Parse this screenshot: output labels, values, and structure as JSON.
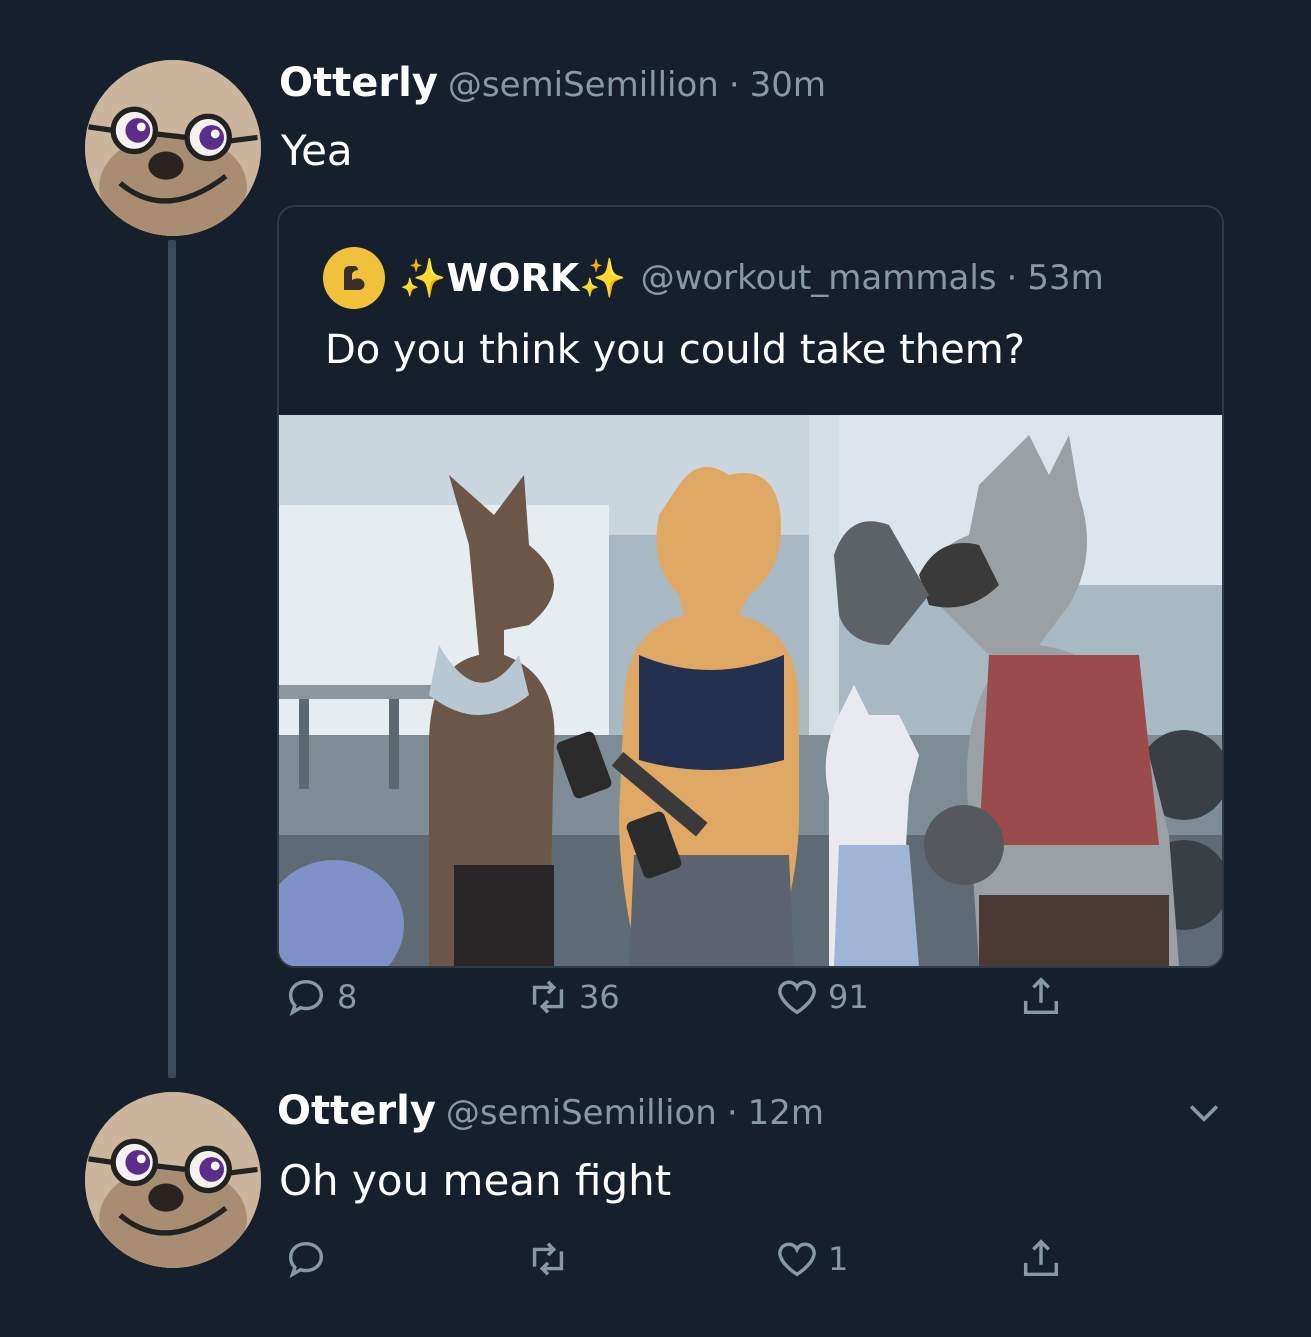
{
  "tweet1": {
    "name": "Otterly",
    "handle": "@semiSemillion",
    "separator": "·",
    "time": "30m",
    "text": "Yea",
    "quote": {
      "name": "✨WORK✨",
      "handle": "@workout_mammals",
      "separator": "·",
      "time": "53m",
      "text": "Do you think you could take them?"
    },
    "actions": {
      "replies": "8",
      "retweets": "36",
      "likes": "91"
    }
  },
  "tweet2": {
    "name": "Otterly",
    "handle": "@semiSemillion",
    "separator": "·",
    "time": "12m",
    "text": "Oh you mean fight",
    "actions": {
      "replies": "",
      "retweets": "",
      "likes": "1"
    }
  },
  "icons": {
    "reply": "reply-icon",
    "retweet": "retweet-icon",
    "like": "heart-icon",
    "share": "share-icon",
    "more": "chevron-down-icon"
  },
  "colors": {
    "background": "#16202c",
    "secondary_text": "#8899a6",
    "thread_line": "#3b4a5a",
    "card_border": "#2d3a48"
  }
}
